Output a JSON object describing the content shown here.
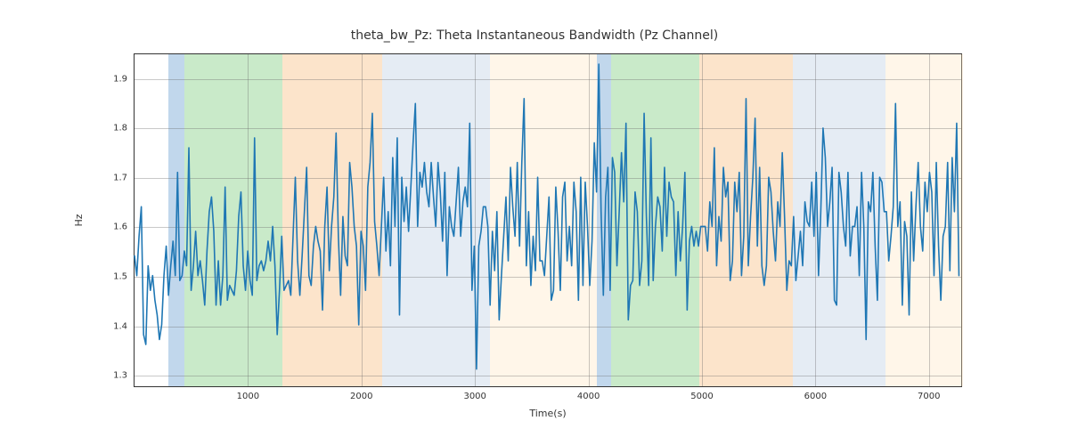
{
  "chart_data": {
    "type": "line",
    "title": "theta_bw_Pz: Theta Instantaneous Bandwidth (Pz Channel)",
    "xlabel": "Time(s)",
    "ylabel": "Hz",
    "xlim": [
      0,
      7300
    ],
    "ylim": [
      1.275,
      1.95
    ],
    "xticks": [
      1000,
      2000,
      3000,
      4000,
      5000,
      6000,
      7000
    ],
    "yticks": [
      1.3,
      1.4,
      1.5,
      1.6,
      1.7,
      1.8,
      1.9
    ],
    "spans": [
      {
        "kind": "blue",
        "x0": 300,
        "x1": 440
      },
      {
        "kind": "green",
        "x0": 440,
        "x1": 1300
      },
      {
        "kind": "orange",
        "x0": 1300,
        "x1": 2180
      },
      {
        "kind": "lblue",
        "x0": 2180,
        "x1": 3130
      },
      {
        "kind": "cream",
        "x0": 3130,
        "x1": 4070
      },
      {
        "kind": "blue",
        "x0": 4070,
        "x1": 4200
      },
      {
        "kind": "green",
        "x0": 4200,
        "x1": 4980
      },
      {
        "kind": "orange",
        "x0": 4980,
        "x1": 5800
      },
      {
        "kind": "lblue",
        "x0": 5800,
        "x1": 6620
      },
      {
        "kind": "cream",
        "x0": 6620,
        "x1": 7300
      }
    ],
    "x": [
      0,
      20,
      40,
      60,
      80,
      100,
      120,
      140,
      160,
      180,
      200,
      220,
      240,
      260,
      280,
      300,
      320,
      340,
      360,
      380,
      400,
      420,
      440,
      460,
      480,
      500,
      520,
      540,
      560,
      580,
      600,
      620,
      640,
      660,
      680,
      700,
      720,
      740,
      760,
      780,
      800,
      820,
      840,
      860,
      880,
      900,
      920,
      940,
      960,
      980,
      1000,
      1020,
      1040,
      1060,
      1080,
      1100,
      1120,
      1140,
      1160,
      1180,
      1200,
      1220,
      1240,
      1260,
      1280,
      1300,
      1320,
      1340,
      1360,
      1380,
      1400,
      1420,
      1440,
      1460,
      1480,
      1500,
      1520,
      1540,
      1560,
      1580,
      1600,
      1620,
      1640,
      1660,
      1680,
      1700,
      1720,
      1740,
      1760,
      1780,
      1800,
      1820,
      1840,
      1860,
      1880,
      1900,
      1920,
      1940,
      1960,
      1980,
      2000,
      2020,
      2040,
      2060,
      2080,
      2100,
      2120,
      2140,
      2160,
      2180,
      2200,
      2220,
      2240,
      2260,
      2280,
      2300,
      2320,
      2340,
      2360,
      2380,
      2400,
      2420,
      2440,
      2460,
      2480,
      2500,
      2520,
      2540,
      2560,
      2580,
      2600,
      2620,
      2640,
      2660,
      2680,
      2700,
      2720,
      2740,
      2760,
      2780,
      2800,
      2820,
      2840,
      2860,
      2880,
      2900,
      2920,
      2940,
      2960,
      2980,
      3000,
      3020,
      3040,
      3060,
      3080,
      3100,
      3120,
      3140,
      3160,
      3180,
      3200,
      3220,
      3240,
      3260,
      3280,
      3300,
      3320,
      3340,
      3360,
      3380,
      3400,
      3420,
      3440,
      3460,
      3480,
      3500,
      3520,
      3540,
      3560,
      3580,
      3600,
      3620,
      3640,
      3660,
      3680,
      3700,
      3720,
      3740,
      3760,
      3780,
      3800,
      3820,
      3840,
      3860,
      3880,
      3900,
      3920,
      3940,
      3960,
      3980,
      4000,
      4020,
      4040,
      4060,
      4080,
      4100,
      4120,
      4140,
      4160,
      4180,
      4200,
      4220,
      4240,
      4260,
      4280,
      4300,
      4320,
      4340,
      4360,
      4380,
      4400,
      4420,
      4440,
      4460,
      4480,
      4500,
      4520,
      4540,
      4560,
      4580,
      4600,
      4620,
      4640,
      4660,
      4680,
      4700,
      4720,
      4740,
      4760,
      4780,
      4800,
      4820,
      4840,
      4860,
      4880,
      4900,
      4920,
      4940,
      4960,
      4980,
      5000,
      5020,
      5040,
      5060,
      5080,
      5100,
      5120,
      5140,
      5160,
      5180,
      5200,
      5220,
      5240,
      5260,
      5280,
      5300,
      5320,
      5340,
      5360,
      5380,
      5400,
      5420,
      5440,
      5460,
      5480,
      5500,
      5520,
      5540,
      5560,
      5580,
      5600,
      5620,
      5640,
      5660,
      5680,
      5700,
      5720,
      5740,
      5760,
      5780,
      5800,
      5820,
      5840,
      5860,
      5880,
      5900,
      5920,
      5940,
      5960,
      5980,
      6000,
      6020,
      6040,
      6060,
      6080,
      6100,
      6120,
      6140,
      6160,
      6180,
      6200,
      6220,
      6240,
      6260,
      6280,
      6300,
      6320,
      6340,
      6360,
      6380,
      6400,
      6420,
      6440,
      6460,
      6480,
      6500,
      6520,
      6540,
      6560,
      6580,
      6600,
      6620,
      6640,
      6660,
      6680,
      6700,
      6720,
      6740,
      6760,
      6780,
      6800,
      6820,
      6840,
      6860,
      6880,
      6900,
      6920,
      6940,
      6960,
      6980,
      7000,
      7020,
      7040,
      7060,
      7080,
      7100,
      7120,
      7140,
      7160,
      7180,
      7200,
      7220,
      7240,
      7260,
      7280
    ],
    "y": [
      1.54,
      1.5,
      1.58,
      1.64,
      1.38,
      1.36,
      1.52,
      1.47,
      1.5,
      1.45,
      1.42,
      1.37,
      1.4,
      1.5,
      1.56,
      1.46,
      1.52,
      1.57,
      1.5,
      1.71,
      1.49,
      1.5,
      1.55,
      1.52,
      1.76,
      1.47,
      1.52,
      1.59,
      1.5,
      1.53,
      1.49,
      1.44,
      1.55,
      1.63,
      1.66,
      1.59,
      1.44,
      1.53,
      1.44,
      1.5,
      1.68,
      1.45,
      1.48,
      1.47,
      1.46,
      1.51,
      1.62,
      1.67,
      1.52,
      1.47,
      1.55,
      1.49,
      1.46,
      1.78,
      1.49,
      1.52,
      1.53,
      1.51,
      1.53,
      1.57,
      1.53,
      1.6,
      1.52,
      1.38,
      1.47,
      1.58,
      1.47,
      1.48,
      1.49,
      1.46,
      1.58,
      1.7,
      1.53,
      1.46,
      1.54,
      1.63,
      1.72,
      1.5,
      1.48,
      1.56,
      1.6,
      1.57,
      1.55,
      1.43,
      1.6,
      1.68,
      1.51,
      1.6,
      1.66,
      1.79,
      1.58,
      1.46,
      1.62,
      1.54,
      1.52,
      1.73,
      1.68,
      1.6,
      1.56,
      1.4,
      1.59,
      1.56,
      1.47,
      1.68,
      1.73,
      1.83,
      1.61,
      1.56,
      1.5,
      1.6,
      1.7,
      1.55,
      1.63,
      1.52,
      1.74,
      1.6,
      1.78,
      1.42,
      1.7,
      1.61,
      1.68,
      1.59,
      1.68,
      1.77,
      1.85,
      1.6,
      1.71,
      1.68,
      1.73,
      1.67,
      1.64,
      1.73,
      1.66,
      1.6,
      1.73,
      1.67,
      1.57,
      1.71,
      1.5,
      1.64,
      1.6,
      1.58,
      1.65,
      1.72,
      1.58,
      1.65,
      1.68,
      1.64,
      1.81,
      1.47,
      1.56,
      1.31,
      1.56,
      1.59,
      1.64,
      1.64,
      1.6,
      1.44,
      1.59,
      1.51,
      1.63,
      1.41,
      1.5,
      1.58,
      1.66,
      1.53,
      1.72,
      1.64,
      1.58,
      1.73,
      1.56,
      1.73,
      1.86,
      1.52,
      1.63,
      1.48,
      1.58,
      1.51,
      1.7,
      1.53,
      1.53,
      1.5,
      1.58,
      1.66,
      1.45,
      1.47,
      1.68,
      1.59,
      1.47,
      1.66,
      1.69,
      1.53,
      1.6,
      1.52,
      1.69,
      1.63,
      1.45,
      1.7,
      1.48,
      1.69,
      1.6,
      1.48,
      1.57,
      1.77,
      1.67,
      1.93,
      1.63,
      1.46,
      1.66,
      1.72,
      1.47,
      1.74,
      1.71,
      1.52,
      1.63,
      1.75,
      1.65,
      1.81,
      1.41,
      1.48,
      1.49,
      1.67,
      1.63,
      1.48,
      1.53,
      1.83,
      1.62,
      1.48,
      1.78,
      1.49,
      1.6,
      1.66,
      1.64,
      1.55,
      1.72,
      1.58,
      1.69,
      1.66,
      1.65,
      1.5,
      1.63,
      1.53,
      1.6,
      1.71,
      1.43,
      1.57,
      1.6,
      1.56,
      1.59,
      1.56,
      1.6,
      1.6,
      1.6,
      1.55,
      1.65,
      1.6,
      1.76,
      1.52,
      1.62,
      1.57,
      1.72,
      1.66,
      1.69,
      1.49,
      1.53,
      1.69,
      1.63,
      1.71,
      1.5,
      1.58,
      1.86,
      1.52,
      1.62,
      1.7,
      1.82,
      1.56,
      1.72,
      1.52,
      1.48,
      1.52,
      1.7,
      1.67,
      1.59,
      1.53,
      1.65,
      1.6,
      1.75,
      1.62,
      1.47,
      1.53,
      1.52,
      1.62,
      1.49,
      1.54,
      1.59,
      1.52,
      1.65,
      1.61,
      1.6,
      1.69,
      1.58,
      1.71,
      1.5,
      1.63,
      1.8,
      1.74,
      1.6,
      1.65,
      1.72,
      1.45,
      1.44,
      1.71,
      1.67,
      1.6,
      1.56,
      1.71,
      1.54,
      1.6,
      1.6,
      1.64,
      1.5,
      1.71,
      1.6,
      1.37,
      1.65,
      1.63,
      1.71,
      1.56,
      1.45,
      1.7,
      1.69,
      1.63,
      1.63,
      1.53,
      1.58,
      1.64,
      1.85,
      1.6,
      1.65,
      1.44,
      1.61,
      1.58,
      1.42,
      1.67,
      1.53,
      1.64,
      1.73,
      1.6,
      1.55,
      1.69,
      1.63,
      1.71,
      1.67,
      1.5,
      1.73,
      1.56,
      1.45,
      1.58,
      1.6,
      1.73,
      1.51,
      1.74,
      1.63,
      1.81,
      1.5
    ]
  }
}
